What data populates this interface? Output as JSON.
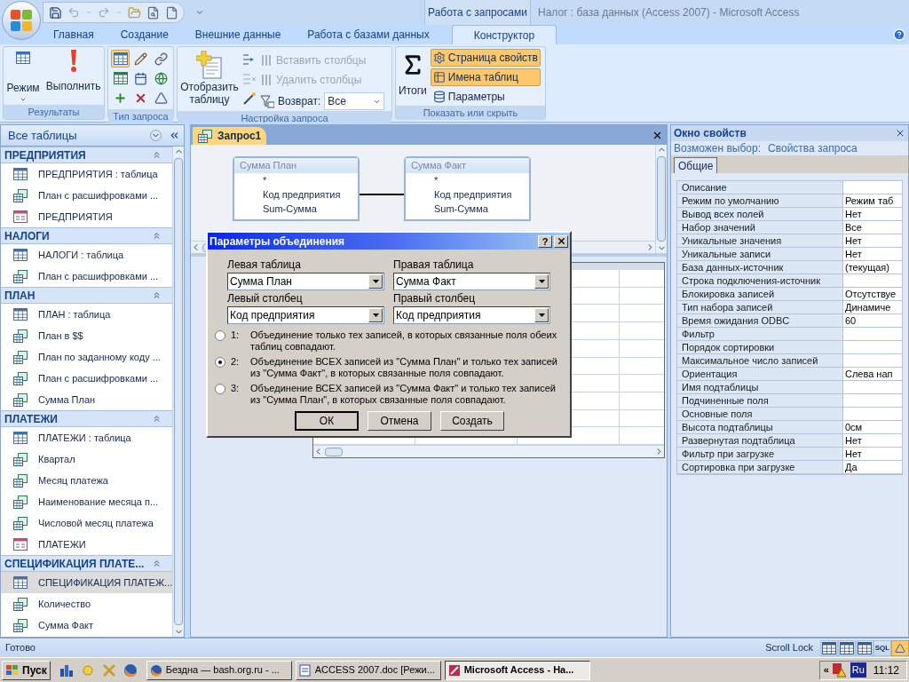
{
  "title_bar": {
    "context_tab": "Работа с запросами",
    "title": "Налог : база данных (Access 2007) - Microsoft Access"
  },
  "ribbon_tabs": [
    {
      "label": "Главная",
      "selected": false
    },
    {
      "label": "Создание",
      "selected": false
    },
    {
      "label": "Внешние данные",
      "selected": false
    },
    {
      "label": "Работа с базами данных",
      "selected": false
    },
    {
      "label": "Конструктор",
      "selected": true
    }
  ],
  "ribbon": {
    "results": {
      "label": "Результаты",
      "view": "Режим",
      "run": "Выполнить"
    },
    "query_type": {
      "label": "Тип запроса",
      "buttons": [
        {
          "selected": true
        },
        {
          "selected": false
        },
        {
          "selected": false
        },
        {
          "selected": false
        },
        {
          "selected": false
        },
        {
          "selected": false
        },
        {
          "selected": false
        },
        {
          "selected": false
        },
        {
          "selected": false
        }
      ]
    },
    "query_setup": {
      "label": "Настройка запроса",
      "show_table": "Отобразить таблицу",
      "insert_columns": {
        "label": "Вставить столбцы",
        "disabled": true
      },
      "delete_columns": {
        "label": "Удалить столбцы",
        "disabled": true
      },
      "return_label": "Возврат:",
      "return_value": "Все"
    },
    "show_hide": {
      "label": "Показать или скрыть",
      "totals": "Итоги",
      "items": [
        {
          "label": "Страница свойств",
          "selected": true
        },
        {
          "label": "Имена таблиц",
          "selected": true
        },
        {
          "label": "Параметры",
          "selected": false
        }
      ]
    }
  },
  "navigation": {
    "title": "Все таблицы",
    "groups": [
      {
        "label": "ПРЕДПРИЯТИЯ",
        "items": [
          {
            "kind": "table",
            "label": "ПРЕДПРИЯТИЯ : таблица",
            "selected": false
          },
          {
            "kind": "query",
            "label": "План с расшифровками ...",
            "selected": false
          },
          {
            "kind": "form",
            "label": "ПРЕДПРИЯТИЯ",
            "selected": false
          }
        ]
      },
      {
        "label": "НАЛОГИ",
        "items": [
          {
            "kind": "table",
            "label": "НАЛОГИ : таблица",
            "selected": false
          },
          {
            "kind": "query",
            "label": "План с расшифровками ...",
            "selected": false
          }
        ]
      },
      {
        "label": "ПЛАН",
        "items": [
          {
            "kind": "table",
            "label": "ПЛАН : таблица",
            "selected": false
          },
          {
            "kind": "query",
            "label": "План в $$",
            "selected": false
          },
          {
            "kind": "query",
            "label": "План по заданному коду ...",
            "selected": false
          },
          {
            "kind": "query",
            "label": "План с расшифровками ...",
            "selected": false
          },
          {
            "kind": "query",
            "label": "Сумма План",
            "selected": false
          }
        ]
      },
      {
        "label": "ПЛАТЕЖИ",
        "items": [
          {
            "kind": "table",
            "label": "ПЛАТЕЖИ : таблица",
            "selected": false
          },
          {
            "kind": "query",
            "label": "Квартал",
            "selected": false
          },
          {
            "kind": "query",
            "label": "Месяц платежа",
            "selected": false
          },
          {
            "kind": "query",
            "label": "Наименование месяца п...",
            "selected": false
          },
          {
            "kind": "query",
            "label": "Числовой месяц платежа",
            "selected": false
          },
          {
            "kind": "form",
            "label": "ПЛАТЕЖИ",
            "selected": false
          }
        ]
      },
      {
        "label": "СПЕЦИФИКАЦИЯ ПЛАТЕ...",
        "items": [
          {
            "kind": "table",
            "label": "СПЕЦИФИКАЦИЯ ПЛАТЕЖ...",
            "selected": true
          },
          {
            "kind": "query",
            "label": "Количество",
            "selected": false
          },
          {
            "kind": "query",
            "label": "Сумма Факт",
            "selected": false
          }
        ]
      }
    ]
  },
  "document": {
    "tab": "Запрос1",
    "tables": [
      {
        "title": "Сумма План",
        "fields": [
          "*",
          "Код предприятия",
          "Sum-Сумма"
        ]
      },
      {
        "title": "Сумма Факт",
        "fields": [
          "*",
          "Код предприятия",
          "Sum-Сумма"
        ]
      }
    ]
  },
  "dialog": {
    "title": "Параметры объединения",
    "help": "?",
    "left_table_label": "Левая таблица",
    "left_table": "Сумма План",
    "right_table_label": "Правая таблица",
    "right_table": "Сумма Факт",
    "left_column_label": "Левый столбец",
    "left_column": "Код предприятия",
    "right_column_label": "Правый столбец",
    "right_column": "Код предприятия",
    "options": [
      {
        "number": "1:",
        "text": "Объединение только тех записей, в которых связанные поля обеих таблиц совпадают.",
        "selected": false
      },
      {
        "number": "2:",
        "text": "Объединение ВСЕХ записей из \"Сумма План\" и только тех записей из \"Сумма Факт\", в которых связанные поля совпадают.",
        "selected": true
      },
      {
        "number": "3:",
        "text": "Объединение ВСЕХ записей из \"Сумма Факт\" и только тех записей из \"Сумма План\", в которых связанные поля совпадают.",
        "selected": false
      }
    ],
    "buttons": [
      {
        "label": "ОК",
        "default": true
      },
      {
        "label": "Отмена",
        "default": false
      },
      {
        "label": "Создать",
        "default": false
      }
    ]
  },
  "property_sheet": {
    "title": "Окно свойств",
    "selection_label": "Возможен выбор:",
    "selection_value": "Свойства запроса",
    "tabs": [
      {
        "label": "Общие",
        "selected": true
      }
    ],
    "properties": [
      {
        "name": "Описание"
      },
      {
        "name": "Режим по умолчанию",
        "value": "Режим таб"
      },
      {
        "name": "Вывод всех полей",
        "value": "Нет"
      },
      {
        "name": "Набор значений",
        "value": "Все"
      },
      {
        "name": "Уникальные значения",
        "value": "Нет"
      },
      {
        "name": "Уникальные записи",
        "value": "Нет"
      },
      {
        "name": "База данных-источник",
        "value": "(текущая)"
      },
      {
        "name": "Строка подключения-источник"
      },
      {
        "name": "Блокировка записей",
        "value": "Отсутствуе"
      },
      {
        "name": "Тип набора записей",
        "value": "Динамиче"
      },
      {
        "name": "Время ожидания ODBC",
        "value": "60"
      },
      {
        "name": "Фильтр"
      },
      {
        "name": "Порядок сортировки"
      },
      {
        "name": "Максимальное число записей"
      },
      {
        "name": "Ориентация",
        "value": "Слева нап"
      },
      {
        "name": "Имя подтаблицы"
      },
      {
        "name": "Подчиненные поля"
      },
      {
        "name": "Основные поля"
      },
      {
        "name": "Высота подтаблицы",
        "value": "0см"
      },
      {
        "name": "Развернутая подтаблица",
        "value": "Нет"
      },
      {
        "name": "Фильтр при загрузке",
        "value": "Нет"
      },
      {
        "name": "Сортировка при загрузке",
        "value": "Да"
      }
    ]
  },
  "status_bar": {
    "text": "Готово",
    "scroll_lock": "Scroll Lock",
    "views": [
      {
        "selected": false
      },
      {
        "selected": false
      },
      {
        "selected": false
      },
      {
        "label": "SQL",
        "selected": false
      },
      {
        "selected": true
      }
    ]
  },
  "taskbar": {
    "start": "Пуск",
    "tasks": [
      {
        "label": "Бездна — bash.org.ru - ...",
        "selected": false
      },
      {
        "label": "ACCESS 2007.doc [Режи...",
        "selected": false
      },
      {
        "label": "Microsoft Access - На...",
        "selected": true
      }
    ],
    "tray_chevron": "«",
    "language": "Ru",
    "time": "11:12"
  }
}
